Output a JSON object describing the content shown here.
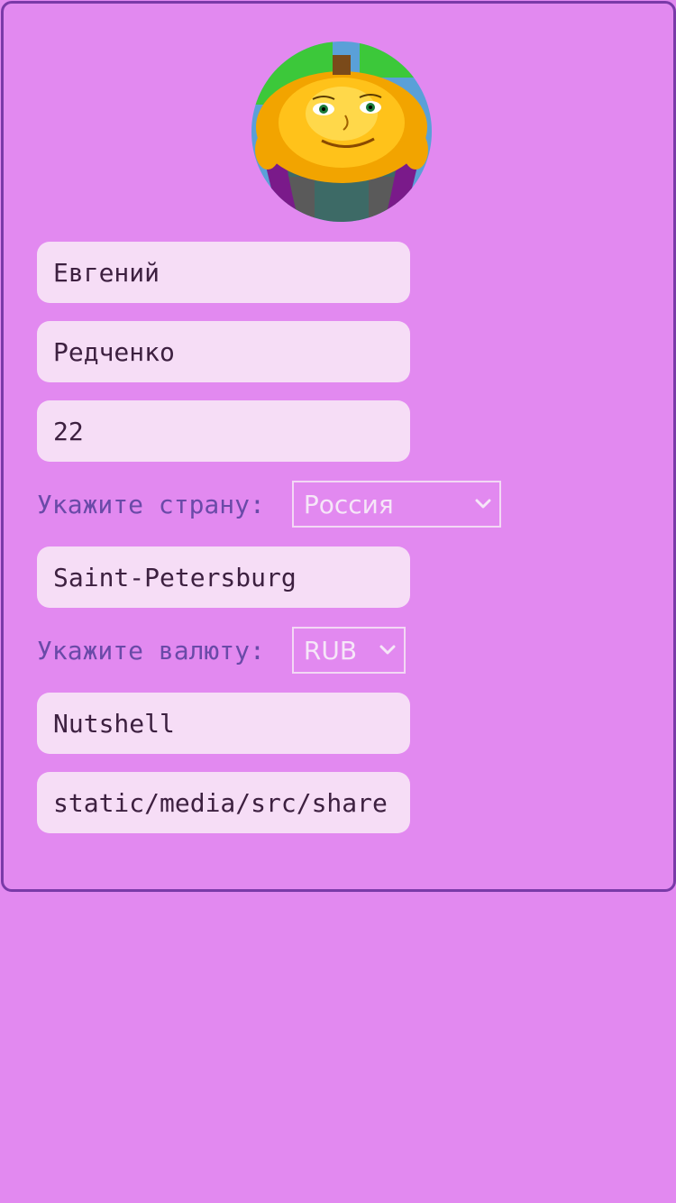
{
  "profile": {
    "avatar_icon": "pumpkin-character-avatar",
    "first_name": "Евгений",
    "last_name": "Редченко",
    "age": "22",
    "country_label": "Укажите страну:",
    "country_value": "Россия",
    "city": "Saint-Petersburg",
    "currency_label": "Укажите валюту:",
    "currency_value": "RUB",
    "nickname": "Nutshell",
    "avatar_path": "static/media/src/share"
  },
  "colors": {
    "background": "#e289f0",
    "card_border": "#7a3aa8",
    "field_bg": "#f6ddf6",
    "label_color": "#6a4aa8"
  },
  "icons": {
    "select_chevron": "chevron-down-icon"
  }
}
